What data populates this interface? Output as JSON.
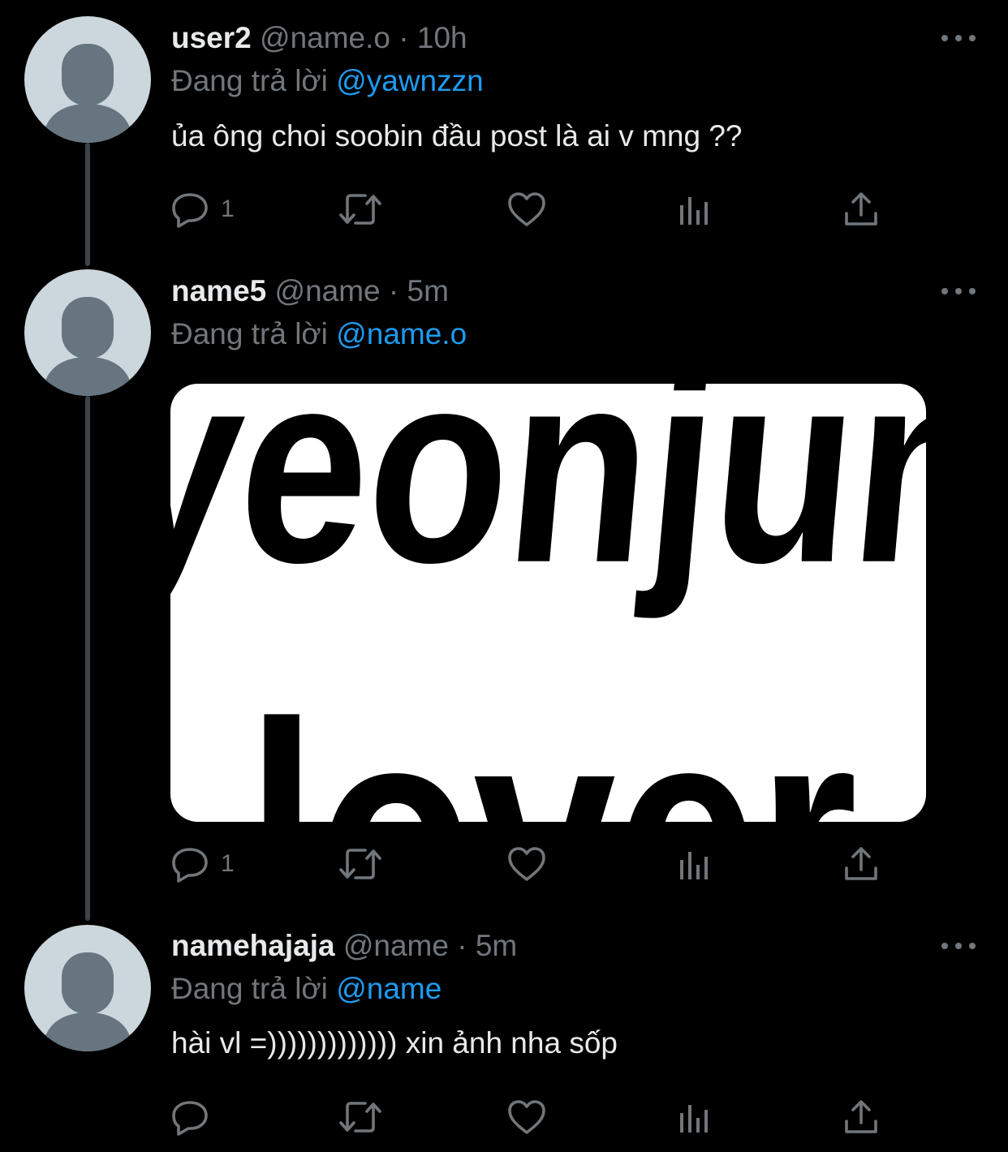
{
  "tweets": [
    {
      "display_name": "user2",
      "handle": "@name.o",
      "separator": "·",
      "time": "10h",
      "reply_prefix": "Đang trả lời",
      "reply_to": "@yawnzzn",
      "text": "ủa ông choi soobin đầu post là ai v mng ??",
      "reply_count": "1"
    },
    {
      "display_name": "name5",
      "handle": "@name",
      "separator": "·",
      "time": "5m",
      "reply_prefix": "Đang trả lời",
      "reply_to": "@name.o",
      "media_text_top": "yeonjun",
      "media_text_bottom": "lover",
      "reply_count": "1"
    },
    {
      "display_name": "namehajaja",
      "handle": "@name",
      "separator": "·",
      "time": "5m",
      "reply_prefix": "Đang trả lời",
      "reply_to": "@name",
      "text": "hài vl =))))))))))))) xin ảnh nha sốp",
      "reply_count": ""
    }
  ],
  "icons": {
    "reply": "reply-icon",
    "retweet": "retweet-icon",
    "like": "heart-icon",
    "analytics": "analytics-icon",
    "share": "share-icon",
    "more": "more-icon"
  },
  "colors": {
    "background": "#000000",
    "text": "#e7e9ea",
    "muted": "#71767b",
    "mention": "#1d9bf0",
    "avatar_bg": "#ccd6dd",
    "avatar_fg": "#66757f"
  }
}
